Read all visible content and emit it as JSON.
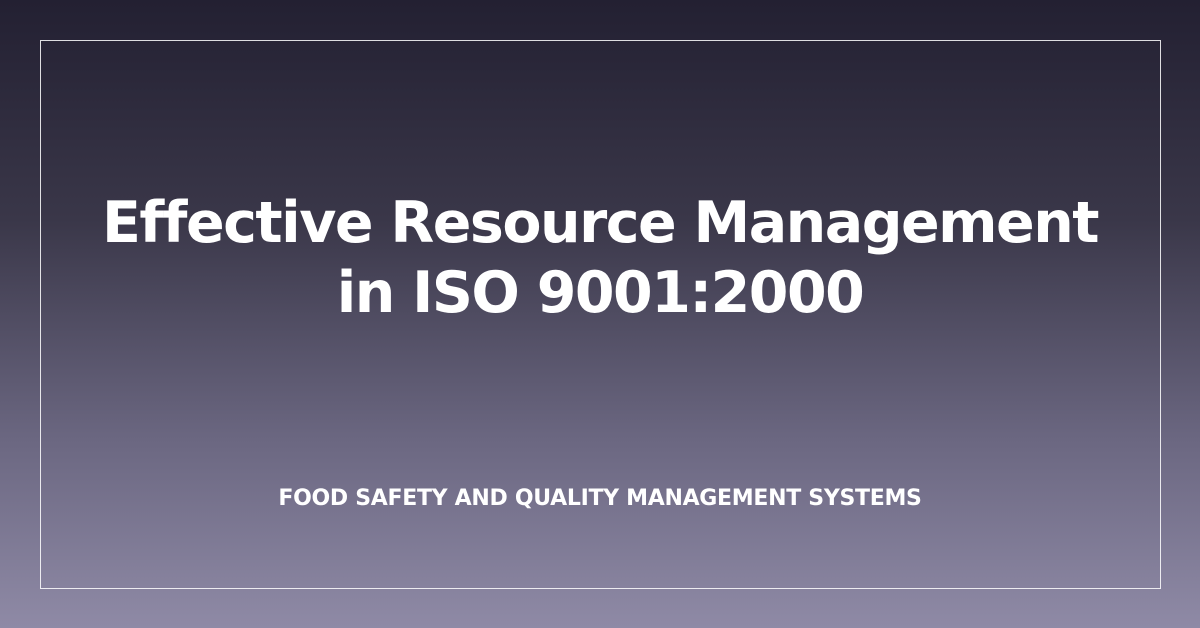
{
  "card": {
    "title_line_1": "Effective Resource Management",
    "title_line_2": "in ISO 9001:2000",
    "subtitle": "FOOD SAFETY AND QUALITY MANAGEMENT SYSTEMS"
  },
  "colors": {
    "background_top": "#232032",
    "background_bottom": "#8f8aa6",
    "text": "#ffffff",
    "frame_border": "#ffffff"
  }
}
